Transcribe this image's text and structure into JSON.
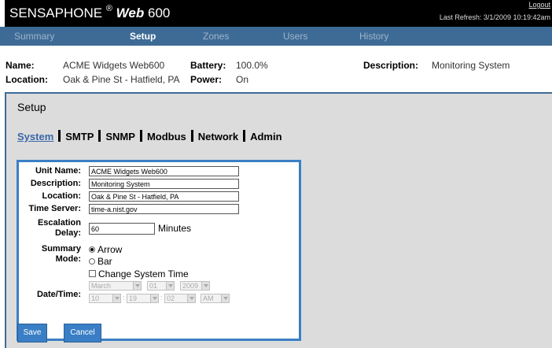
{
  "header": {
    "brand_name": "SENSAPHONE",
    "brand_reg": "®",
    "brand_web": "Web",
    "brand_model": "600",
    "logout": "Logout",
    "last_refresh": "Last Refresh: 3/1/2009 10:19:42am"
  },
  "nav": {
    "tabs": [
      {
        "label": "Summary"
      },
      {
        "label": "Setup"
      },
      {
        "label": "Zones"
      },
      {
        "label": "Users"
      },
      {
        "label": "History"
      }
    ],
    "active": "Setup"
  },
  "info": {
    "name_label": "Name:",
    "name_value": "ACME Widgets Web600",
    "location_label": "Location:",
    "location_value": "Oak & Pine St - Hatfield, PA",
    "battery_label": "Battery:",
    "battery_value": "100.0%",
    "power_label": "Power:",
    "power_value": "On",
    "description_label": "Description:",
    "description_value": "Monitoring System"
  },
  "setup": {
    "title": "Setup",
    "subtabs": [
      {
        "label": "System"
      },
      {
        "label": "SMTP"
      },
      {
        "label": "SNMP"
      },
      {
        "label": "Modbus"
      },
      {
        "label": "Network"
      },
      {
        "label": "Admin"
      }
    ],
    "active_subtab": "System"
  },
  "form": {
    "unit_name_label": "Unit Name:",
    "unit_name_value": "ACME Widgets Web600",
    "description_label": "Description:",
    "description_value": "Monitoring System",
    "location_label": "Location:",
    "location_value": "Oak & Pine St - Hatfield, PA",
    "time_server_label": "Time Server:",
    "time_server_value": "time-a.nist.gov",
    "escalation_label_1": "Escalation",
    "escalation_label_2": "Delay:",
    "escalation_value": "60",
    "escalation_unit": "Minutes",
    "summary_label_1": "Summary",
    "summary_label_2": "Mode:",
    "mode_options": [
      {
        "label": "Arrow",
        "selected": true
      },
      {
        "label": "Bar",
        "selected": false
      }
    ],
    "change_time_label": "Change System Time",
    "datetime_label": "Date/Time:",
    "month": "March",
    "day": "01",
    "year": "2009",
    "hour": "10",
    "minute": "19",
    "second": "02",
    "ampm": "AM",
    "time_sep": ":"
  },
  "buttons": {
    "save": "Save",
    "cancel": "Cancel"
  },
  "colors": {
    "nav_bg": "#3e6b95",
    "accent": "#3a7fc6",
    "panel_bg": "#dcdcdc",
    "topbar_bg": "#000000"
  }
}
